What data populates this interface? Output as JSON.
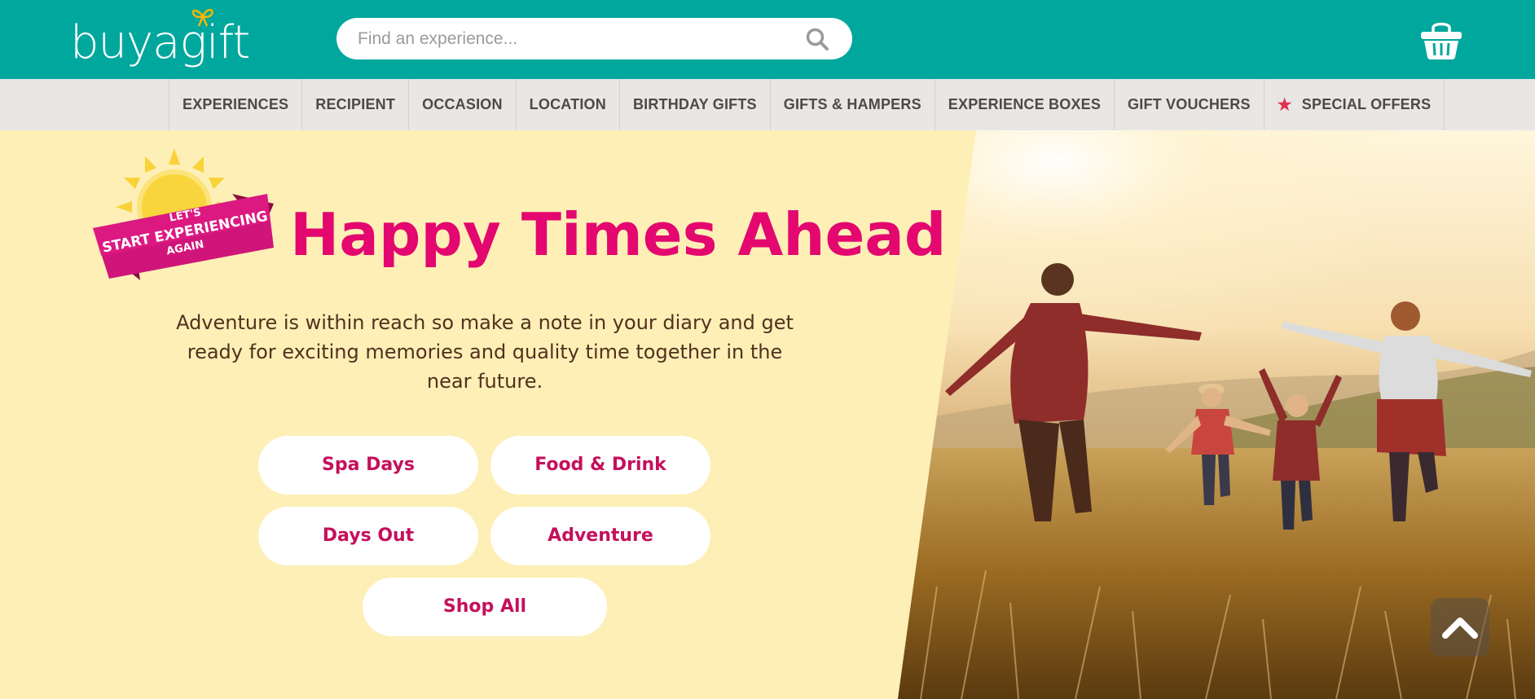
{
  "header": {
    "logo_text": "buyagift",
    "search_placeholder": "Find an experience..."
  },
  "nav": {
    "items": [
      {
        "label": "EXPERIENCES"
      },
      {
        "label": "RECIPIENT"
      },
      {
        "label": "OCCASION"
      },
      {
        "label": "LOCATION"
      },
      {
        "label": "BIRTHDAY GIFTS"
      },
      {
        "label": "GIFTS & HAMPERS"
      },
      {
        "label": "EXPERIENCE BOXES"
      },
      {
        "label": "GIFT VOUCHERS"
      },
      {
        "label": "SPECIAL OFFERS",
        "icon": "star-icon"
      }
    ]
  },
  "hero": {
    "badge_line1": "LET'S",
    "badge_line2": "START EXPERIENCING",
    "badge_line3": "AGAIN",
    "headline": "Happy Times Ahead",
    "intro": "Adventure is within reach so make a note in your diary and get ready for exciting memories and quality time together in the near future.",
    "buttons": {
      "spa": "Spa Days",
      "food": "Food & Drink",
      "days_out": "Days Out",
      "adventure": "Adventure",
      "shop_all": "Shop All"
    }
  },
  "colors": {
    "header_teal": "#00a79d",
    "nav_bg": "#e8e7e6",
    "hero_cream": "#fdefb6",
    "headline_pink": "#e3076f",
    "button_text": "#c4105c"
  }
}
